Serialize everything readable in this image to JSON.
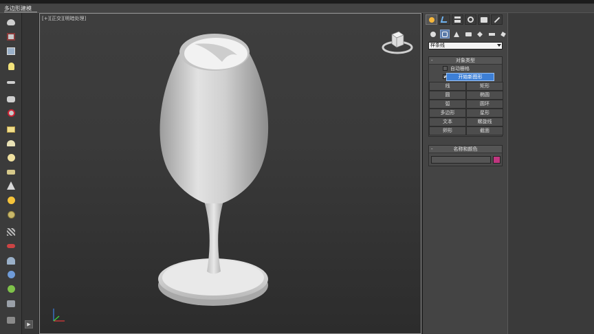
{
  "menubar": {
    "items": [
      "",
      "",
      "",
      "",
      ""
    ]
  },
  "ribbon": {
    "tab_label": "多边形建模"
  },
  "viewport": {
    "label_plus": "[+]",
    "label_view": "[正交]",
    "label_shading": "[明暗处理]"
  },
  "command_panel": {
    "dropdown_value": "样条线",
    "object_type": {
      "title": "对象类型",
      "auto_grid": "自动栅格",
      "start_new_shape_checked": "✔",
      "start_new_shape": "开始新图形",
      "buttons": [
        [
          "线",
          "矩形"
        ],
        [
          "圆",
          "椭圆"
        ],
        [
          "弧",
          "圆环"
        ],
        [
          "多边形",
          "星形"
        ],
        [
          "文本",
          "螺旋线"
        ],
        [
          "卵形",
          "截面"
        ]
      ]
    },
    "name_color": {
      "title": "名称和颜色",
      "swatch_color": "#c0367f"
    }
  },
  "colors": {
    "accent_blue": "#3d7fd6",
    "object_color": "#c0367f"
  }
}
